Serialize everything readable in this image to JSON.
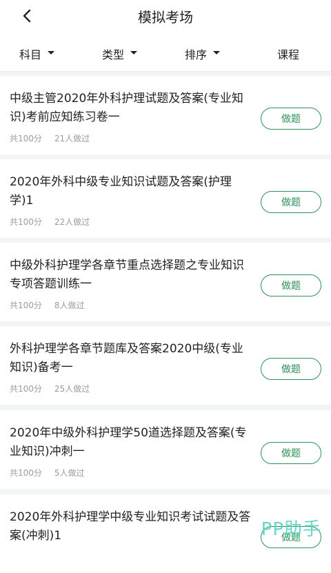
{
  "header": {
    "title": "模拟考场",
    "back_icon": "chevron-left-icon"
  },
  "filters": [
    {
      "label": "科目",
      "has_caret": true
    },
    {
      "label": "类型",
      "has_caret": true
    },
    {
      "label": "排序",
      "has_caret": true
    },
    {
      "label": "课程",
      "has_caret": false
    }
  ],
  "exams": [
    {
      "title": "中级主管2020年外科护理试题及答案(专业知识)考前应知练习卷一",
      "total": "共100分",
      "participants": "21人做过",
      "action": "做题"
    },
    {
      "title": "2020年外科中级专业知识试题及答案(护理学)1",
      "total": "共100分",
      "participants": "22人做过",
      "action": "做题"
    },
    {
      "title": "中级外科护理学各章节重点选择题之专业知识专项答题训练一",
      "total": "共100分",
      "participants": "8人做过",
      "action": "做题"
    },
    {
      "title": "外科护理学各章节题库及答案2020中级(专业知识)备考一",
      "total": "共100分",
      "participants": "25人做过",
      "action": "做题"
    },
    {
      "title": "2020年中级外科护理学50道选择题及答案(专业知识)冲刺一",
      "total": "共100分",
      "participants": "5人做过",
      "action": "做题"
    },
    {
      "title": "2020年外科护理学中级专业知识考试试题及答案(冲刺)1",
      "total": "",
      "participants": "",
      "action": "做题"
    }
  ],
  "watermark": "PP助手",
  "colors": {
    "accent": "#2e8f57",
    "watermark": "#56d2c3",
    "background": "#f3f4f6"
  }
}
